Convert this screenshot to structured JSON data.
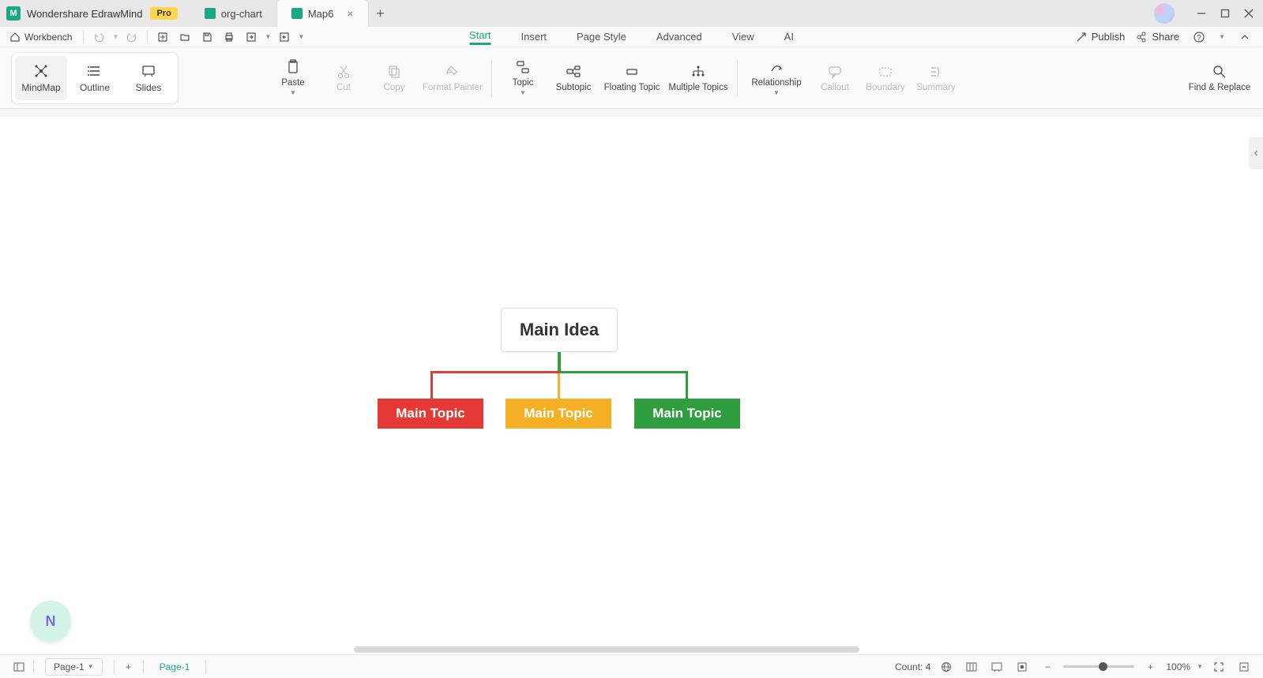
{
  "app": {
    "name": "Wondershare EdrawMind",
    "pro": "Pro"
  },
  "tabs": [
    {
      "label": "org-chart",
      "active": false
    },
    {
      "label": "Map6",
      "active": true
    }
  ],
  "quickbar": {
    "workbench": "Workbench"
  },
  "menu": {
    "start": "Start",
    "insert": "Insert",
    "pagestyle": "Page Style",
    "advanced": "Advanced",
    "view": "View",
    "ai": "AI"
  },
  "titleright": {
    "publish": "Publish",
    "share": "Share"
  },
  "views": {
    "mindmap": "MindMap",
    "outline": "Outline",
    "slides": "Slides"
  },
  "tools": {
    "paste": "Paste",
    "cut": "Cut",
    "copy": "Copy",
    "format": "Format Painter",
    "topic": "Topic",
    "subtopic": "Subtopic",
    "floating": "Floating Topic",
    "multiple": "Multiple Topics",
    "relationship": "Relationship",
    "callout": "Callout",
    "boundary": "Boundary",
    "summary": "Summary",
    "find": "Find & Replace"
  },
  "mindmap": {
    "root": "Main Idea",
    "topic1": "Main Topic",
    "topic2": "Main Topic",
    "topic3": "Main Topic"
  },
  "status": {
    "page_sel": "Page-1",
    "page_active": "Page-1",
    "count": "Count: 4",
    "zoom": "100%"
  }
}
